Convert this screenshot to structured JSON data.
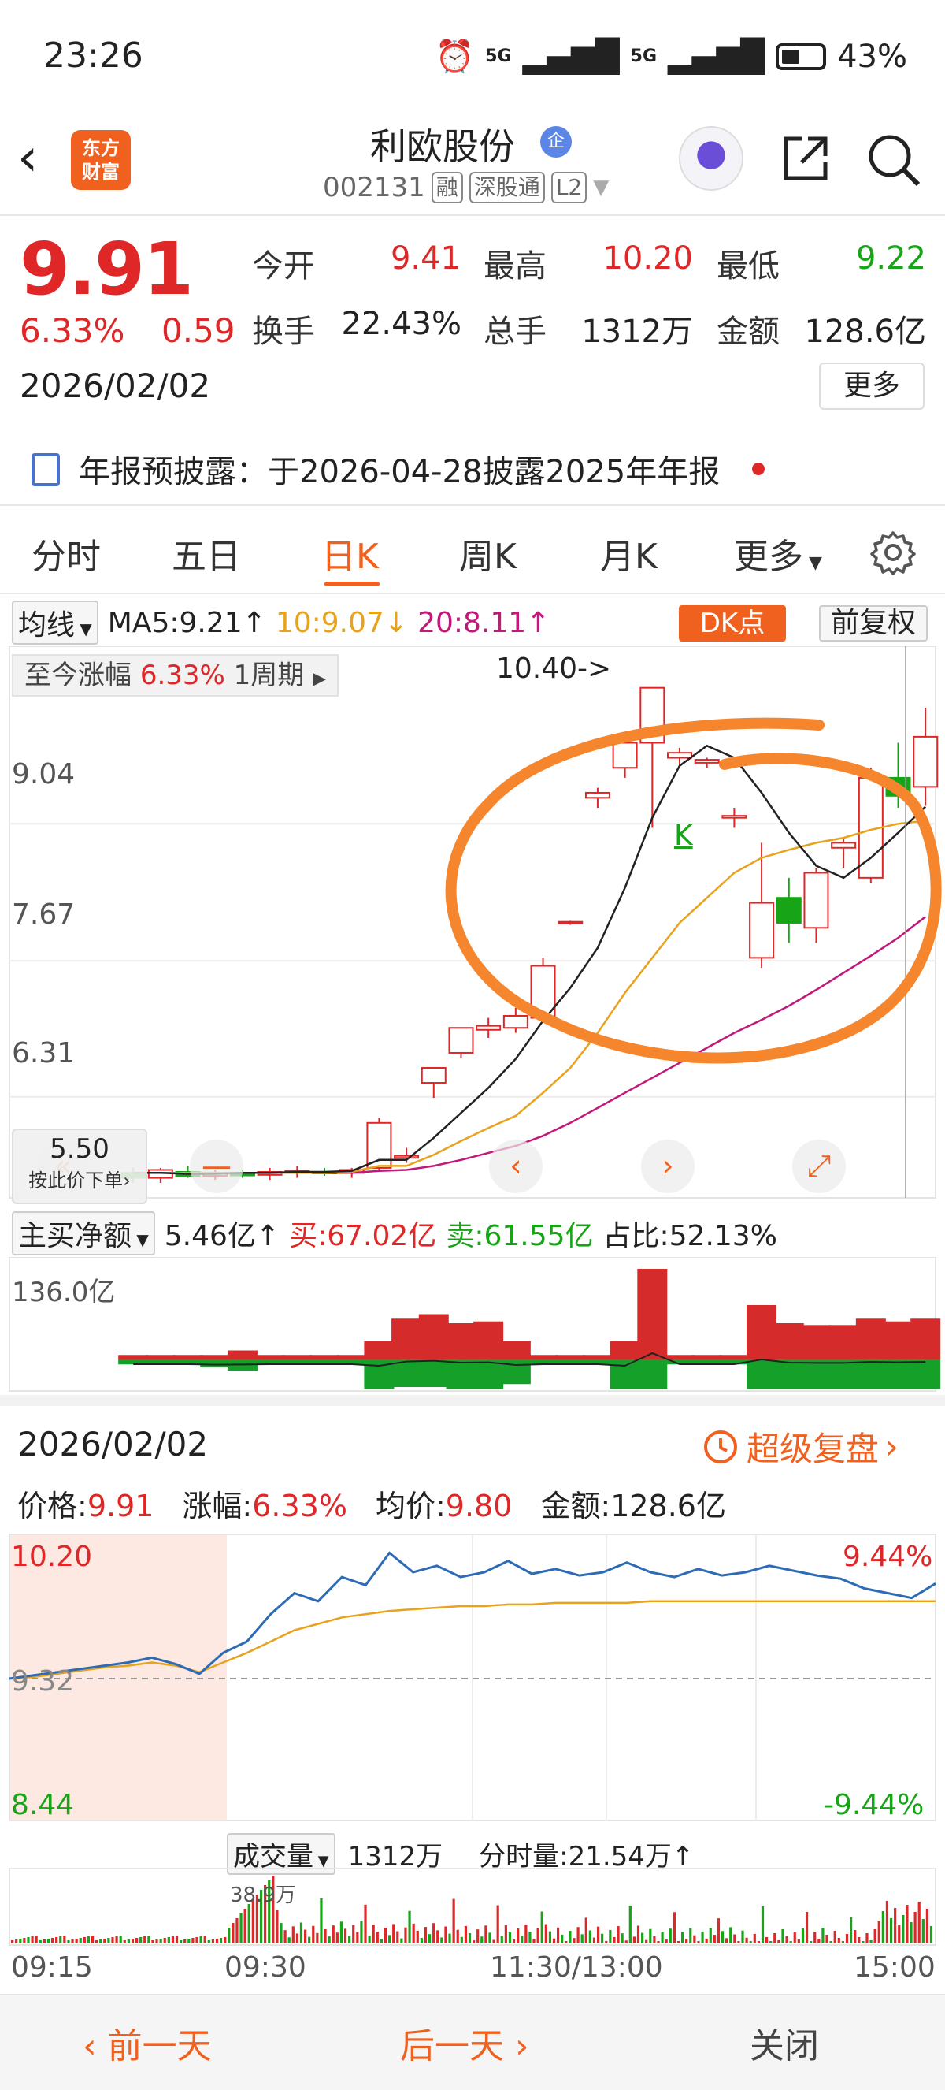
{
  "status_bar": {
    "time": "23:26",
    "signal1": "5G",
    "signal2": "5G",
    "battery": "43%"
  },
  "header": {
    "logo_line1": "东方",
    "logo_line2": "财富",
    "stock_name": "利欧股份",
    "ent_badge": "企",
    "stock_code": "002131",
    "tags": [
      "融",
      "深股通",
      "L2"
    ]
  },
  "quote": {
    "price": "9.91",
    "change_pct": "6.33%",
    "change_val": "0.59",
    "date": "2026/02/02",
    "fields": [
      {
        "label": "今开",
        "value": "9.41",
        "color": "red"
      },
      {
        "label": "最高",
        "value": "10.20",
        "color": "red"
      },
      {
        "label": "最低",
        "value": "9.22",
        "color": "green"
      },
      {
        "label": "换手",
        "value": "22.43%",
        "color": "black"
      },
      {
        "label": "总手",
        "value": "1312万",
        "color": "black"
      },
      {
        "label": "金额",
        "value": "128.6亿",
        "color": "black"
      }
    ],
    "more_label": "更多"
  },
  "notice": {
    "text": "年报预披露：于2026-04-28披露2025年年报"
  },
  "tabs": [
    "分时",
    "五日",
    "日K",
    "周K",
    "月K",
    "更多"
  ],
  "ma_row": {
    "selector": "均线",
    "ma5": "MA5:9.21",
    "ma10": "10:9.07",
    "ma20": "20:8.11",
    "dk_label": "DK点",
    "fq_label": "前复权"
  },
  "kline": {
    "period_label": "至今涨幅",
    "period_pct": "6.33%",
    "period_unit": "1周期",
    "y_labels": [
      "9.04",
      "7.67",
      "6.31"
    ],
    "high_marker": "10.40->",
    "k_marker": "K",
    "tip_value": "5.50",
    "tip_hint": "按此价下单"
  },
  "chart_data": {
    "type": "candlestick",
    "ylim": [
      5.3,
      10.5
    ],
    "y_ticks": [
      9.04,
      7.67,
      6.31
    ],
    "candles": [
      {
        "o": 5.55,
        "h": 5.6,
        "l": 5.45,
        "c": 5.5
      },
      {
        "o": 5.5,
        "h": 5.6,
        "l": 5.45,
        "c": 5.58
      },
      {
        "o": 5.56,
        "h": 5.62,
        "l": 5.5,
        "c": 5.52
      },
      {
        "o": 5.52,
        "h": 5.58,
        "l": 5.48,
        "c": 5.55
      },
      {
        "o": 5.54,
        "h": 5.58,
        "l": 5.5,
        "c": 5.53
      },
      {
        "o": 5.53,
        "h": 5.6,
        "l": 5.48,
        "c": 5.56
      },
      {
        "o": 5.55,
        "h": 5.62,
        "l": 5.5,
        "c": 5.57
      },
      {
        "o": 5.56,
        "h": 5.6,
        "l": 5.52,
        "c": 5.55
      },
      {
        "o": 5.55,
        "h": 5.6,
        "l": 5.5,
        "c": 5.58
      },
      {
        "o": 5.6,
        "h": 6.1,
        "l": 5.58,
        "c": 6.05
      },
      {
        "o": 5.7,
        "h": 5.8,
        "l": 5.65,
        "c": 5.72
      },
      {
        "o": 6.45,
        "h": 6.6,
        "l": 6.3,
        "c": 6.6
      },
      {
        "o": 6.75,
        "h": 7.0,
        "l": 6.7,
        "c": 7.0
      },
      {
        "o": 6.98,
        "h": 7.1,
        "l": 6.9,
        "c": 7.02
      },
      {
        "o": 7.0,
        "h": 7.2,
        "l": 6.95,
        "c": 7.12
      },
      {
        "o": 7.1,
        "h": 7.7,
        "l": 7.05,
        "c": 7.62
      },
      {
        "o": 8.05,
        "h": 8.07,
        "l": 8.03,
        "c": 8.06
      },
      {
        "o": 9.3,
        "h": 9.4,
        "l": 9.2,
        "c": 9.35
      },
      {
        "o": 9.6,
        "h": 9.95,
        "l": 9.5,
        "c": 9.85
      },
      {
        "o": 9.85,
        "h": 10.2,
        "l": 9.0,
        "c": 10.4
      },
      {
        "o": 9.7,
        "h": 9.8,
        "l": 9.6,
        "c": 9.75
      },
      {
        "o": 9.65,
        "h": 9.7,
        "l": 9.6,
        "c": 9.68
      },
      {
        "o": 9.1,
        "h": 9.2,
        "l": 9.0,
        "c": 9.12
      },
      {
        "o": 7.7,
        "h": 8.85,
        "l": 7.6,
        "c": 8.25
      },
      {
        "o": 8.3,
        "h": 8.5,
        "l": 7.85,
        "c": 8.05
      },
      {
        "o": 8.0,
        "h": 8.6,
        "l": 7.85,
        "c": 8.55
      },
      {
        "o": 8.8,
        "h": 8.9,
        "l": 8.6,
        "c": 8.85
      },
      {
        "o": 8.5,
        "h": 9.6,
        "l": 8.45,
        "c": 9.5
      },
      {
        "o": 9.5,
        "h": 9.85,
        "l": 9.2,
        "c": 9.32
      },
      {
        "o": 9.41,
        "h": 10.2,
        "l": 9.22,
        "c": 9.91
      }
    ],
    "ma5": [
      5.55,
      5.55,
      5.54,
      5.54,
      5.55,
      5.55,
      5.56,
      5.56,
      5.57,
      5.68,
      5.68,
      5.9,
      6.15,
      6.4,
      6.69,
      7.07,
      7.4,
      7.8,
      8.4,
      9.1,
      9.62,
      9.82,
      9.7,
      9.35,
      8.95,
      8.62,
      8.5,
      8.7,
      8.95,
      9.21
    ],
    "ma10": [
      5.55,
      5.55,
      5.55,
      5.55,
      5.55,
      5.55,
      5.55,
      5.55,
      5.56,
      5.62,
      5.62,
      5.73,
      5.87,
      6.0,
      6.12,
      6.35,
      6.6,
      6.95,
      7.35,
      7.7,
      8.05,
      8.3,
      8.55,
      8.7,
      8.78,
      8.85,
      8.9,
      8.98,
      9.04,
      9.07
    ],
    "ma20": [
      5.55,
      5.55,
      5.55,
      5.55,
      5.55,
      5.55,
      5.55,
      5.55,
      5.55,
      5.57,
      5.58,
      5.62,
      5.68,
      5.75,
      5.82,
      5.92,
      6.05,
      6.2,
      6.35,
      6.5,
      6.65,
      6.8,
      6.95,
      7.08,
      7.22,
      7.38,
      7.55,
      7.72,
      7.9,
      8.11
    ]
  },
  "capital_flow": {
    "selector": "主买净额",
    "net": "5.46亿",
    "buy": "买:67.02亿",
    "sell": "卖:61.55亿",
    "ratio": "占比:52.13%",
    "max_label": "136.0亿",
    "buy_bars": [
      0.05,
      0.05,
      0.05,
      0.05,
      0.1,
      0.05,
      0.05,
      0.05,
      0.05,
      0.2,
      0.45,
      0.5,
      0.4,
      0.42,
      0.2,
      0.05,
      0.05,
      0.05,
      0.2,
      1.0,
      0.05,
      0.05,
      0.05,
      0.6,
      0.4,
      0.38,
      0.38,
      0.45,
      0.42,
      0.45
    ],
    "sell_bars": [
      0.05,
      0.05,
      0.05,
      0.08,
      0.12,
      0.05,
      0.05,
      0.05,
      0.05,
      0.3,
      0.28,
      0.28,
      0.3,
      0.3,
      0.25,
      0.05,
      0.05,
      0.05,
      0.3,
      0.3,
      0.05,
      0.05,
      0.05,
      0.3,
      0.3,
      0.3,
      0.3,
      0.3,
      0.3,
      0.3
    ]
  },
  "intraday": {
    "date": "2026/02/02",
    "replay_label": "超级复盘",
    "stats": [
      {
        "label": "价格:",
        "value": "9.91"
      },
      {
        "label": "涨幅:",
        "value": "6.33%"
      },
      {
        "label": "均价:",
        "value": "9.80"
      },
      {
        "label": "金额:",
        "value": "128.6亿"
      }
    ],
    "y_top": "10.20",
    "y_mid": "9.32",
    "y_bot": "8.44",
    "pct_top": "9.44%",
    "pct_bot": "-9.44%",
    "vol_selector": "成交量",
    "vol_total": "1312万",
    "vol_tick": "分时量:21.54万",
    "vol_max": "38.9万",
    "times": [
      "09:15",
      "09:30",
      "11:30/13:00",
      "15:00"
    ],
    "price_series": [
      9.32,
      9.34,
      9.36,
      9.38,
      9.4,
      9.42,
      9.45,
      9.41,
      9.35,
      9.48,
      9.55,
      9.72,
      9.85,
      9.8,
      9.95,
      9.9,
      10.1,
      9.98,
      10.02,
      9.95,
      9.98,
      10.05,
      9.97,
      10.0,
      9.96,
      9.98,
      10.04,
      9.98,
      9.95,
      10.0,
      9.96,
      9.98,
      10.02,
      9.99,
      9.96,
      9.94,
      9.88,
      9.85,
      9.82,
      9.91
    ],
    "avg_series": [
      9.32,
      9.33,
      9.35,
      9.37,
      9.39,
      9.4,
      9.42,
      9.4,
      9.36,
      9.42,
      9.48,
      9.55,
      9.62,
      9.66,
      9.7,
      9.72,
      9.74,
      9.75,
      9.76,
      9.77,
      9.77,
      9.78,
      9.78,
      9.79,
      9.79,
      9.79,
      9.79,
      9.8,
      9.8,
      9.8,
      9.8,
      9.8,
      9.8,
      9.8,
      9.8,
      9.8,
      9.8,
      9.8,
      9.8,
      9.8
    ]
  },
  "footer": {
    "prev": "前一天",
    "next": "后一天",
    "close": "关闭"
  }
}
